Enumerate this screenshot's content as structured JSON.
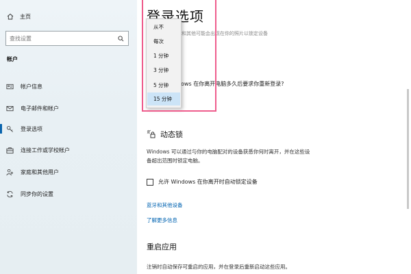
{
  "sidebar": {
    "home_label": "主页",
    "search_placeholder": "查找设置",
    "section_title": "帐户",
    "items": [
      {
        "label": "帐户信息",
        "icon": "person-card-icon"
      },
      {
        "label": "电子邮件和帐户",
        "icon": "mail-icon"
      },
      {
        "label": "登录选项",
        "icon": "key-icon",
        "active": true
      },
      {
        "label": "连接工作或学校帐户",
        "icon": "briefcase-icon"
      },
      {
        "label": "家庭和其他用户",
        "icon": "people-icon"
      },
      {
        "label": "同步你的设置",
        "icon": "sync-icon"
      }
    ]
  },
  "main": {
    "title": "登录选项",
    "faded_subtitle": "和其他可能会出现在你的照片以锁定设备",
    "question": "dows 在你离开电脑多久后要求你重新登录?",
    "dynamic_lock": {
      "title": "动态锁",
      "description_line1": "Windows 可以通过与你的电脑配对的设备获悉你何时离开，并在这些设",
      "description_line2": "备超出范围时锁定电脑。",
      "checkbox_label": "允许 Windows 在你离开时自动锁定设备",
      "checkbox_checked": false,
      "link_bluetooth": "蓝牙和其他设备",
      "link_more": "了解更多信息"
    },
    "restart": {
      "title": "重启应用",
      "description": "注销时自动保存可重启的应用，并在登录后重新启动这些应用。"
    }
  },
  "dropdown": {
    "options": [
      "从不",
      "每次",
      "1 分钟",
      "3 分钟",
      "5 分钟",
      "15 分钟"
    ],
    "selected": "15 分钟"
  },
  "colors": {
    "accent": "#0063b1",
    "highlight_border": "#ee5c8c",
    "selected_option": "#cce4f7"
  }
}
